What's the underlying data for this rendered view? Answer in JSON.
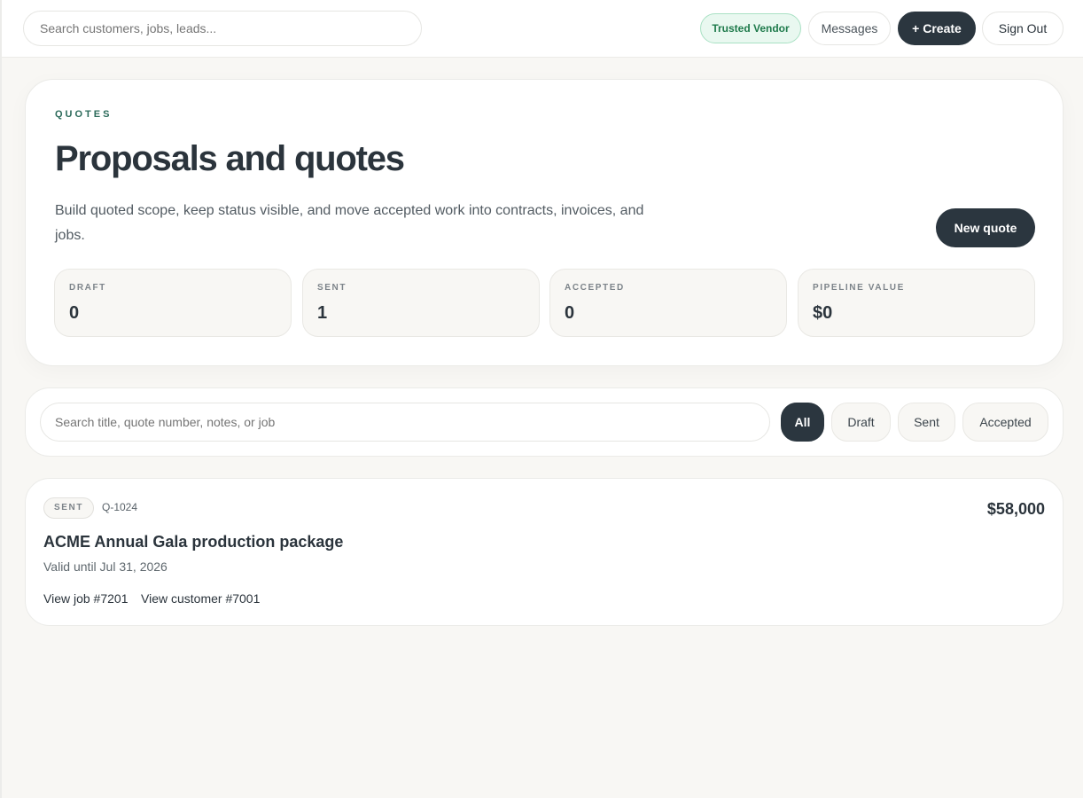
{
  "topbar": {
    "search_placeholder": "Search customers, jobs, leads...",
    "trusted_badge": "Trusted Vendor",
    "messages_label": "Messages",
    "create_label": "+ Create",
    "signout_label": "Sign Out"
  },
  "hero": {
    "eyebrow": "QUOTES",
    "title": "Proposals and quotes",
    "description": "Build quoted scope, keep status visible, and move accepted work into contracts, invoices, and jobs.",
    "new_quote_label": "New quote",
    "stats": [
      {
        "label": "DRAFT",
        "value": "0"
      },
      {
        "label": "SENT",
        "value": "1"
      },
      {
        "label": "ACCEPTED",
        "value": "0"
      },
      {
        "label": "PIPELINE VALUE",
        "value": "$0"
      }
    ]
  },
  "filters": {
    "search_placeholder": "Search title, quote number, notes, or job",
    "options": [
      "All",
      "Draft",
      "Sent",
      "Accepted"
    ],
    "selected": "All"
  },
  "quotes": [
    {
      "status": "SENT",
      "number": "Q-1024",
      "amount": "$58,000",
      "title": "ACME Annual Gala production package",
      "valid_until": "Valid until Jul 31, 2026",
      "job_link": "View job #7201",
      "customer_link": "View customer #7001"
    }
  ],
  "colors": {
    "accent_dark": "#2b363f",
    "trusted_green": "#1e7a4b",
    "eyebrow_teal": "#2b6a5a",
    "page_bg": "#f8f7f4"
  }
}
